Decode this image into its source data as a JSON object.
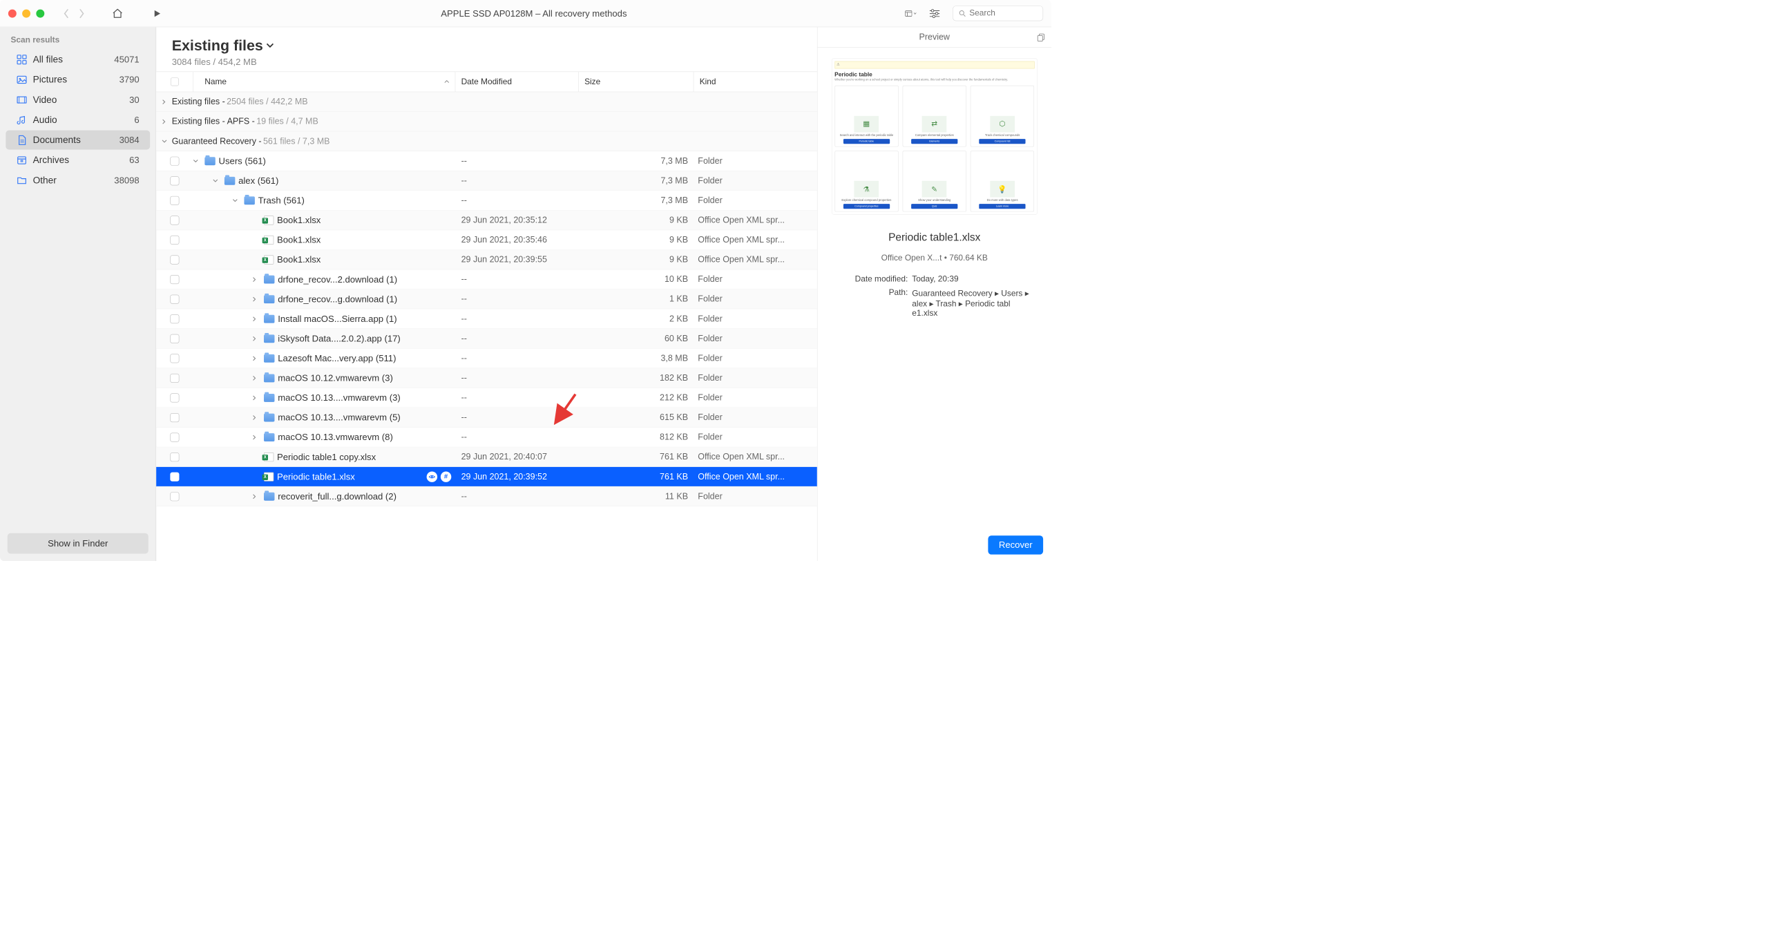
{
  "toolbar": {
    "title": "APPLE SSD AP0128M – All recovery methods",
    "search_placeholder": "Search"
  },
  "sidebar": {
    "header": "Scan results",
    "items": [
      {
        "label": "All files",
        "count": "45071",
        "icon": "grid"
      },
      {
        "label": "Pictures",
        "count": "3790",
        "icon": "picture"
      },
      {
        "label": "Video",
        "count": "30",
        "icon": "video"
      },
      {
        "label": "Audio",
        "count": "6",
        "icon": "audio"
      },
      {
        "label": "Documents",
        "count": "3084",
        "icon": "doc",
        "selected": true
      },
      {
        "label": "Archives",
        "count": "63",
        "icon": "archive"
      },
      {
        "label": "Other",
        "count": "38098",
        "icon": "folder"
      }
    ],
    "show_in_finder": "Show in Finder"
  },
  "content": {
    "title": "Existing files",
    "subtitle": "3084 files / 454,2 MB"
  },
  "columns": {
    "name": "Name",
    "date": "Date Modified",
    "size": "Size",
    "kind": "Kind"
  },
  "sections": [
    {
      "chev": "right",
      "label": "Existing files - ",
      "meta": "2504 files / 442,2 MB"
    },
    {
      "chev": "right",
      "label": "Existing files - APFS - ",
      "meta": "19 files / 4,7 MB"
    },
    {
      "chev": "down",
      "label": "Guaranteed Recovery - ",
      "meta": "561 files / 7,3 MB"
    }
  ],
  "rows": [
    {
      "indent": 0,
      "chev": "down",
      "icon": "folder",
      "name": "Users (561)",
      "date": "--",
      "size": "7,3 MB",
      "kind": "Folder"
    },
    {
      "indent": 1,
      "chev": "down",
      "icon": "folder",
      "name": "alex (561)",
      "date": "--",
      "size": "7,3 MB",
      "kind": "Folder",
      "alt": true
    },
    {
      "indent": 2,
      "chev": "down",
      "icon": "folder",
      "name": "Trash (561)",
      "date": "--",
      "size": "7,3 MB",
      "kind": "Folder"
    },
    {
      "indent": 3,
      "chev": "",
      "icon": "xlsx",
      "name": "Book1.xlsx",
      "date": "29 Jun 2021, 20:35:12",
      "size": "9 KB",
      "kind": "Office Open XML spr...",
      "alt": true
    },
    {
      "indent": 3,
      "chev": "",
      "icon": "xlsx",
      "name": "Book1.xlsx",
      "date": "29 Jun 2021, 20:35:46",
      "size": "9 KB",
      "kind": "Office Open XML spr..."
    },
    {
      "indent": 3,
      "chev": "",
      "icon": "xlsx",
      "name": "Book1.xlsx",
      "date": "29 Jun 2021, 20:39:55",
      "size": "9 KB",
      "kind": "Office Open XML spr...",
      "alt": true
    },
    {
      "indent": 3,
      "chev": "right",
      "icon": "folder",
      "name": "drfone_recov...2.download (1)",
      "date": "--",
      "size": "10 KB",
      "kind": "Folder"
    },
    {
      "indent": 3,
      "chev": "right",
      "icon": "folder",
      "name": "drfone_recov...g.download (1)",
      "date": "--",
      "size": "1 KB",
      "kind": "Folder",
      "alt": true
    },
    {
      "indent": 3,
      "chev": "right",
      "icon": "folder",
      "name": "Install macOS...Sierra.app (1)",
      "date": "--",
      "size": "2 KB",
      "kind": "Folder"
    },
    {
      "indent": 3,
      "chev": "right",
      "icon": "folder",
      "name": "iSkysoft Data....2.0.2).app (17)",
      "date": "--",
      "size": "60 KB",
      "kind": "Folder",
      "alt": true
    },
    {
      "indent": 3,
      "chev": "right",
      "icon": "folder",
      "name": "Lazesoft Mac...very.app (511)",
      "date": "--",
      "size": "3,8 MB",
      "kind": "Folder"
    },
    {
      "indent": 3,
      "chev": "right",
      "icon": "folder",
      "name": "macOS 10.12.vmwarevm (3)",
      "date": "--",
      "size": "182 KB",
      "kind": "Folder",
      "alt": true
    },
    {
      "indent": 3,
      "chev": "right",
      "icon": "folder",
      "name": "macOS 10.13....vmwarevm (3)",
      "date": "--",
      "size": "212 KB",
      "kind": "Folder"
    },
    {
      "indent": 3,
      "chev": "right",
      "icon": "folder",
      "name": "macOS 10.13....vmwarevm (5)",
      "date": "--",
      "size": "615 KB",
      "kind": "Folder",
      "alt": true
    },
    {
      "indent": 3,
      "chev": "right",
      "icon": "folder",
      "name": "macOS 10.13.vmwarevm (8)",
      "date": "--",
      "size": "812 KB",
      "kind": "Folder"
    },
    {
      "indent": 3,
      "chev": "",
      "icon": "xlsx",
      "name": "Periodic table1 copy.xlsx",
      "date": "29 Jun 2021, 20:40:07",
      "size": "761 KB",
      "kind": "Office Open XML spr...",
      "alt": true
    },
    {
      "indent": 3,
      "chev": "",
      "icon": "xlsx",
      "name": "Periodic table1.xlsx",
      "date": "29 Jun 2021, 20:39:52",
      "size": "761 KB",
      "kind": "Office Open XML spr...",
      "selected": true,
      "badges": true
    },
    {
      "indent": 3,
      "chev": "right",
      "icon": "folder",
      "name": "recoverit_full...g.download (2)",
      "date": "--",
      "size": "11 KB",
      "kind": "Folder",
      "alt": true
    }
  ],
  "preview": {
    "header": "Preview",
    "thumb": {
      "title": "Periodic table",
      "sub": "Whether you're working on a school project or simply curious about atoms, this tool will help you discover the fundamentals of chemistry.",
      "cards": [
        {
          "cap": "Search and interact with the periodic table",
          "btn": "Periodic table"
        },
        {
          "cap": "Compare elemental properties",
          "btn": "Elements"
        },
        {
          "cap": "Track chemical compounds",
          "btn": "Compound list"
        },
        {
          "cap": "Explore chemical compound properties",
          "btn": "Compound properties"
        },
        {
          "cap": "Show your understanding",
          "btn": "Quiz"
        },
        {
          "cap": "Do more with data types",
          "btn": "Learn more"
        }
      ]
    },
    "file_name": "Periodic table1.xlsx",
    "meta": "Office Open X...t • 760.64 KB",
    "props": {
      "date_label": "Date modified:",
      "date_value": "Today, 20:39",
      "path_label": "Path:",
      "path_value": "Guaranteed Recovery ▸ Users ▸ alex ▸ Trash ▸ Periodic tabl e1.xlsx"
    },
    "recover": "Recover"
  }
}
